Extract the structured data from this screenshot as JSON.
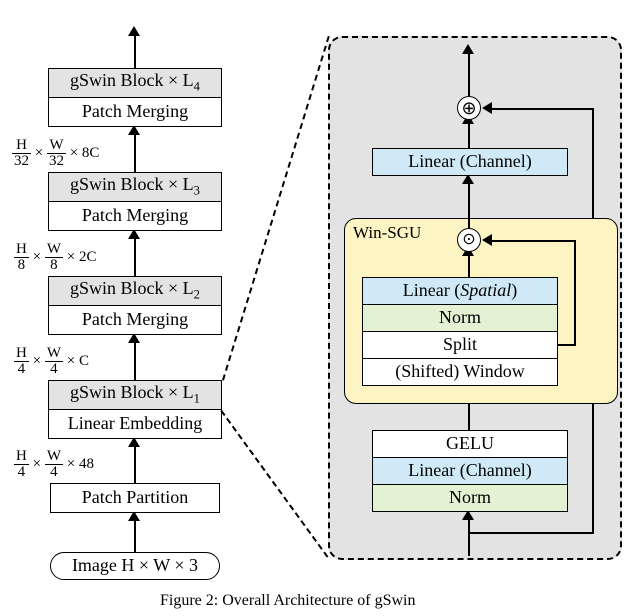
{
  "caption_prefix": "Figure 2: ",
  "caption_text": "Overall Architecture of gSwin",
  "left": {
    "image": "Image  H × W × 3",
    "patch_partition": "Patch Partition",
    "linear_embedding": "Linear Embedding",
    "patch_merging": "Patch Merging",
    "gswin_L1": "gSwin Block × L",
    "gswin_L1_sub": "1",
    "gswin_L2": "gSwin Block × L",
    "gswin_L2_sub": "2",
    "gswin_L3": "gSwin Block × L",
    "gswin_L3_sub": "3",
    "gswin_L4": "gSwin Block × L",
    "gswin_L4_sub": "4",
    "dim_48": "× 48",
    "dim_C": "× C",
    "dim_2C": "× 2C",
    "dim_8C": "× 8C",
    "frac_H4": {
      "num": "H",
      "den": "4"
    },
    "frac_W4": {
      "num": "W",
      "den": "4"
    },
    "frac_H8": {
      "num": "H",
      "den": "8"
    },
    "frac_W8": {
      "num": "W",
      "den": "8"
    },
    "frac_H32": {
      "num": "H",
      "den": "32"
    },
    "frac_W32": {
      "num": "W",
      "den": "32"
    }
  },
  "right": {
    "win_sgu_label": "Win-SGU",
    "norm": "Norm",
    "linear_channel": "Linear (Channel)",
    "gelu": "GELU",
    "shifted_window": "(Shifted) Window",
    "split": "Split",
    "linear_spatial_prefix": "Linear (",
    "linear_spatial_em": "Spatial",
    "linear_spatial_suffix": ")",
    "dot_symbol": "⊙",
    "plus_symbol": "⊕"
  }
}
